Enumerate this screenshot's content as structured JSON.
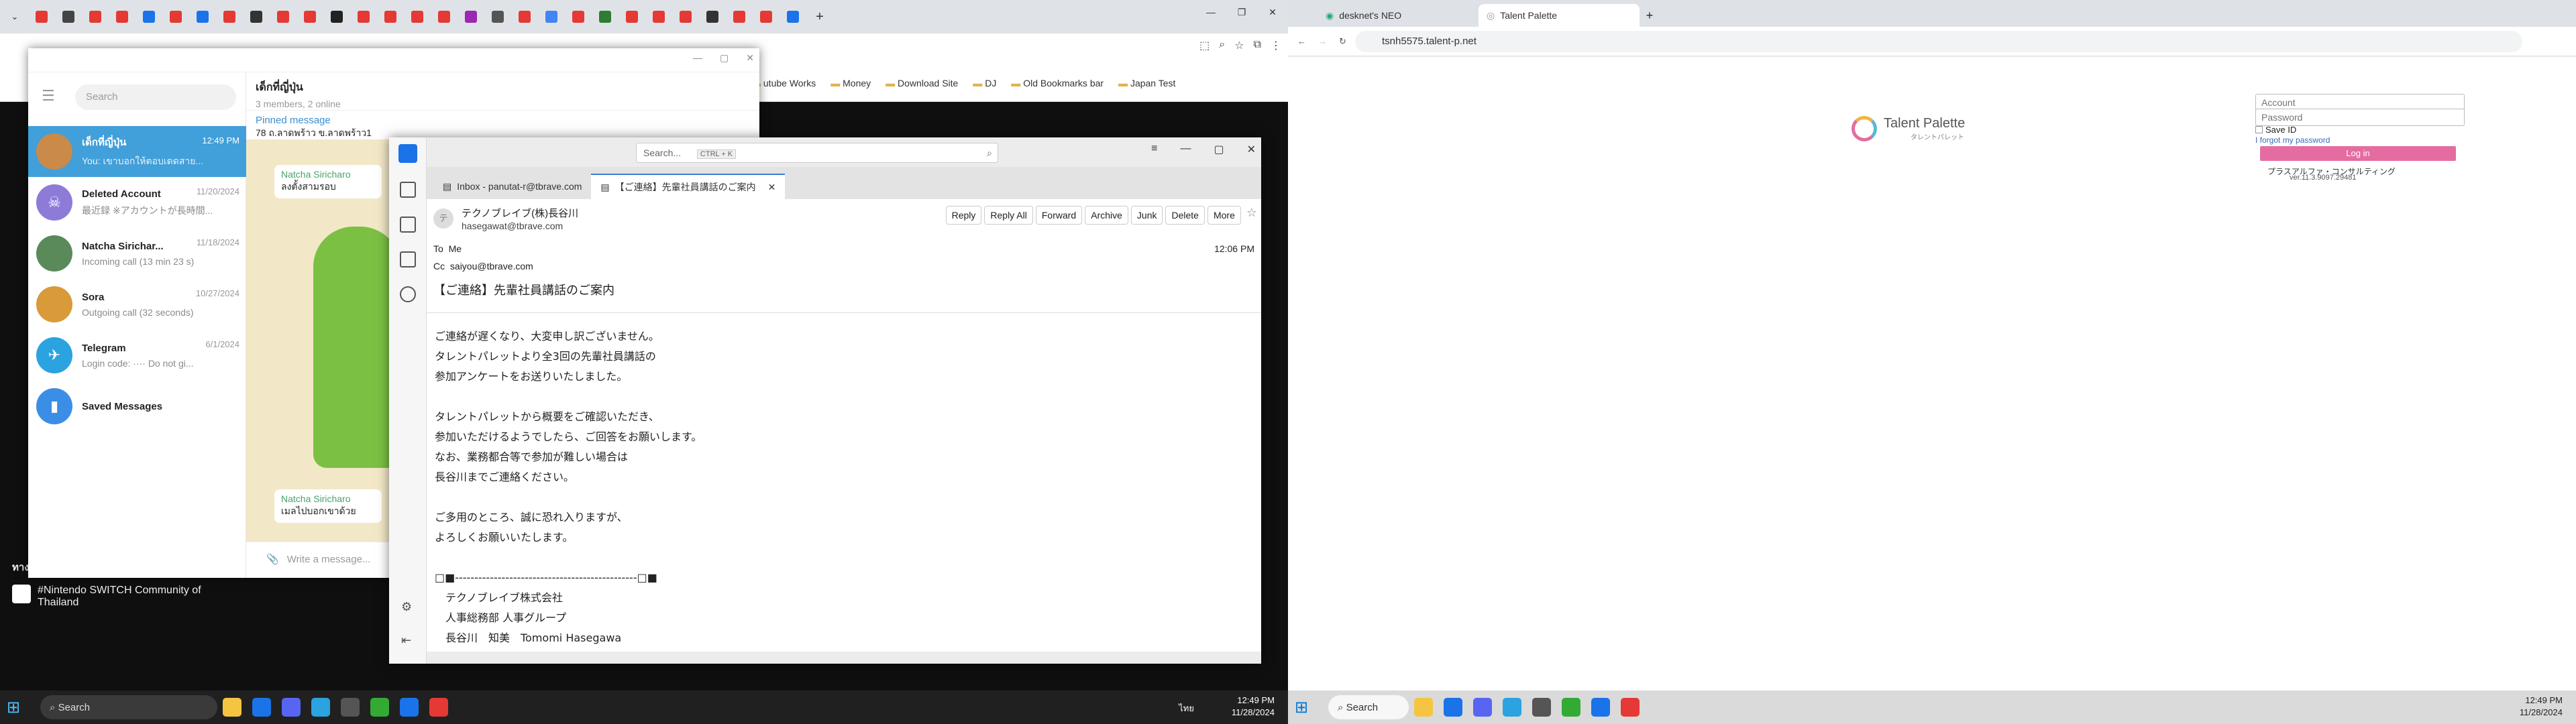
{
  "left": {
    "bookmarks": [
      "utube Works",
      "Money",
      "Download Site",
      "DJ",
      "Old Bookmarks bar",
      "Japan Test"
    ],
    "telegram": {
      "search_placeholder": "Search",
      "chat_title": "เด็กที่ญี่ปุ่น",
      "chat_members": "3 members, 2 online",
      "pinned_label": "Pinned message",
      "pinned_text": "78 ถ.ลาดพร้าว ข.ลาดพร้าว1",
      "msg1_name": "Natcha Siricharo",
      "msg1_text": "ลงตั้งสามรอบ",
      "msg2_name": "Natcha Siricharo",
      "msg2_text": "เมลไปบอกเขาด้วย",
      "compose_placeholder": "Write a message...",
      "chats": [
        {
          "name": "เด็กที่ญี่ปุ่น",
          "preview": "You: เขาบอกให้ตอบเดดสาย...",
          "time": "12:49 PM",
          "color": "#c98a4a",
          "initial": ""
        },
        {
          "name": "Deleted Account",
          "preview": "最近録 ※アカウントが長時間...",
          "time": "11/20/2024",
          "color": "#8e7bd8",
          "initial": "☠"
        },
        {
          "name": "Natcha Sirichar...",
          "preview": "Incoming call (13 min 23 s)",
          "time": "11/18/2024",
          "color": "#5a8a5a",
          "initial": ""
        },
        {
          "name": "Sora",
          "preview": "Outgoing call (32 seconds)",
          "time": "10/27/2024",
          "color": "#d99a3a",
          "initial": ""
        },
        {
          "name": "Telegram",
          "preview": "Login code: ···· Do not gi...",
          "time": "6/1/2024",
          "color": "#2aa3e0",
          "initial": "✈"
        },
        {
          "name": "Saved Messages",
          "preview": "",
          "time": "",
          "color": "#3b8ee6",
          "initial": "🔖"
        }
      ]
    },
    "mail": {
      "search_placeholder": "Search...",
      "search_kbd": "CTRL + K",
      "tab_inbox": "Inbox - panutat-r@tbrave.com",
      "tab_message": "【ご連絡】先輩社員講話のご案内",
      "from_name": "テクノブレイブ(株)長谷川",
      "from_email": "hasegawat@tbrave.com",
      "to_label": "To",
      "to_value": "Me",
      "cc_label": "Cc",
      "cc_value": "saiyou@tbrave.com",
      "time": "12:06 PM",
      "subject": "【ご連絡】先輩社員講話のご案内",
      "buttons": [
        "Reply",
        "Reply All",
        "Forward",
        "Archive",
        "Junk",
        "Delete",
        "More"
      ],
      "body": [
        "ご連絡が遅くなり、大変申し訳ございません。",
        "タレントパレットより全3回の先輩社員講話の",
        "参加アンケートをお送りいたしました。",
        "",
        "タレントパレットから概要をご確認いただき、",
        "参加いただけるようでしたら、ご回答をお願いします。",
        "なお、業務都合等で参加が難しい場合は",
        "長谷川までご連絡ください。",
        "",
        "ご多用のところ、誠に恐れ入りますが、",
        "よろしくお願いいたします。",
        "",
        "□■-----------------------------------------------□■",
        "　テクノブレイブ株式会社",
        "　人事総務部 人事グループ",
        "　長谷川　知美　Tomomi Hasegawa"
      ]
    },
    "youtube": {
      "section": "ทางลัดของคุณ",
      "item": "#Nintendo SWITCH Community of Thailand"
    },
    "taskbar": {
      "search": "Search",
      "time": "12:49 PM",
      "date": "11/28/2024",
      "lang": "ไทย"
    }
  },
  "right": {
    "tabs": [
      "desknet's NEO",
      "Talent Palette"
    ],
    "url": "tsnh5575.talent-p.net",
    "brand": "Talent Palette",
    "brand_sub": "タレントパレット",
    "account_placeholder": "Account",
    "password_placeholder": "Password",
    "save_id": "Save ID",
    "forgot": "I forgot my password",
    "login": "Log in",
    "company": "プラスアルファ・コンサルティング",
    "version": "ver.11.3.9097.29481",
    "taskbar": {
      "search": "Search",
      "time": "12:49 PM",
      "date": "11/28/2024"
    }
  }
}
